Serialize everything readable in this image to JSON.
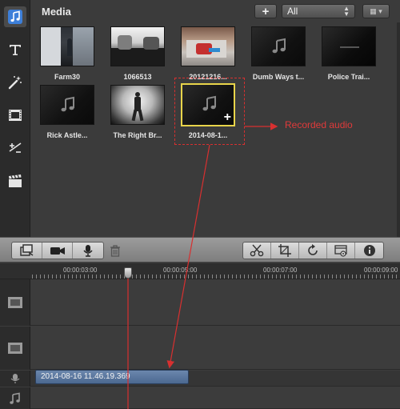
{
  "media_panel": {
    "title": "Media",
    "filter": {
      "selected": "All"
    },
    "clips": [
      {
        "label": "Farm30",
        "kind": "video"
      },
      {
        "label": "1066513",
        "kind": "video"
      },
      {
        "label": "20121216...",
        "kind": "video"
      },
      {
        "label": "Dumb Ways t...",
        "kind": "audio"
      },
      {
        "label": "Police Trai...",
        "kind": "video-dark"
      },
      {
        "label": "Rick Astle...",
        "kind": "audio"
      },
      {
        "label": "The Right Br...",
        "kind": "video"
      },
      {
        "label": "2014-08-1...",
        "kind": "audio",
        "selected": true
      }
    ]
  },
  "annotation": {
    "text": "Recorded audio",
    "color": "#e03a3a"
  },
  "tool_rail": {
    "icons": [
      "music-icon",
      "text-icon",
      "magic-wand-icon",
      "filmstrip-icon",
      "transition-icon",
      "clapperboard-icon"
    ]
  },
  "toolbar": {
    "left_group_icons": [
      "camera-import-icon",
      "video-camera-icon",
      "microphone-icon"
    ],
    "trash_icon": "trash-icon",
    "right_icons": [
      "scissors-icon",
      "crop-icon",
      "rotate-icon",
      "settings-panel-icon",
      "info-icon"
    ]
  },
  "ruler": {
    "ticks": [
      "00:00:03:00",
      "00:00:05:00",
      "00:00:07:00",
      "00:00:09:00"
    ]
  },
  "timeline": {
    "audio_clip_label": "2014-08-16 11.46.19.369",
    "track_icons": [
      "filmstrip-icon",
      "filmstrip-icon",
      "microphone-icon",
      "music-note-icon"
    ]
  },
  "colors": {
    "accent_selected": "#e8d44a",
    "annotation_red": "#d83030",
    "audio_clip": "#5b78a0"
  }
}
